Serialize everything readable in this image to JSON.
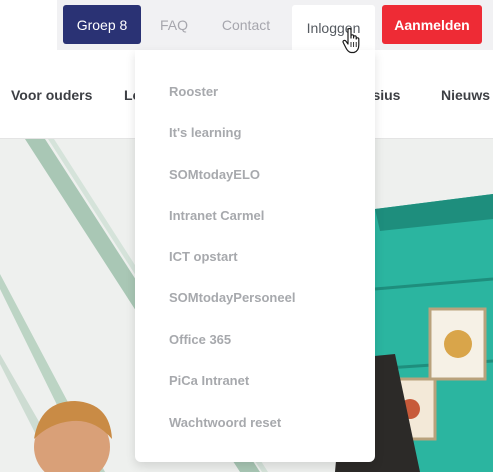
{
  "topbar": {
    "groep_label": "Groep 8",
    "faq_label": "FAQ",
    "contact_label": "Contact",
    "inloggen_label": "Inloggen",
    "aanmelden_label": "Aanmelden"
  },
  "nav": {
    "items": [
      "Voor ouders",
      "Lo",
      "nisius",
      "Nieuws"
    ]
  },
  "dropdown": {
    "items": [
      "Rooster",
      "It's learning",
      "SOMtodayELO",
      "Intranet Carmel",
      "ICT opstart",
      "SOMtodayPersoneel",
      "Office 365",
      "PiCa Intranet",
      "Wachtwoord reset"
    ]
  },
  "colors": {
    "primary_navy": "#2a3274",
    "accent_red": "#ee2b35",
    "teal": "#2bb5a0"
  },
  "icons": {
    "cursor": "hand-pointer-icon"
  }
}
